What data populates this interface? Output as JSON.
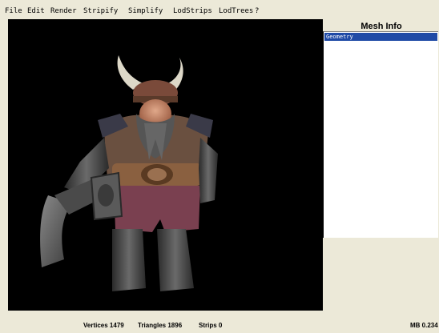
{
  "menu": [
    "File",
    "Edit",
    "Render",
    "Stripify",
    "Simplify",
    "LodStrips",
    "LodTrees",
    "?"
  ],
  "panel": {
    "title": "Mesh Info",
    "items": [
      "Geometry"
    ]
  },
  "status": {
    "vertices": "Vertices 1479",
    "triangles": "Triangles 1896",
    "strips": "Strips 0",
    "mb": "MB 0.234"
  },
  "icons": {
    "viewport_model": "viking-dwarf-3d-model"
  }
}
